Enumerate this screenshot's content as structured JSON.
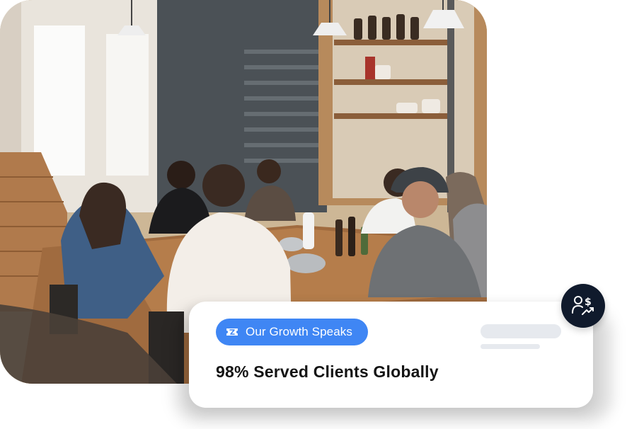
{
  "photo": {
    "subject": "team-meeting-photo"
  },
  "card": {
    "pill_label": "Our Growth Speaks",
    "headline": "98% Served Clients Globally"
  },
  "icons": {
    "pill_icon": "ticket-icon",
    "badge_icon": "client-growth-icon"
  },
  "colors": {
    "accent": "#3f86f4",
    "badge_bg": "#101a2c",
    "headline": "#141414",
    "skeleton": "#e6e9ee"
  }
}
